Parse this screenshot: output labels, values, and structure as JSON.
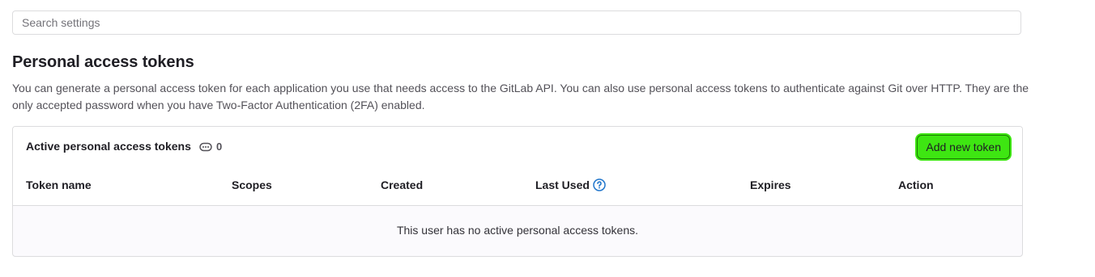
{
  "search": {
    "placeholder": "Search settings"
  },
  "section": {
    "title": "Personal access tokens",
    "description": "You can generate a personal access token for each application you use that needs access to the GitLab API. You can also use personal access tokens to authenticate against Git over HTTP. They are the only accepted password when you have Two-Factor Authentication (2FA) enabled."
  },
  "tokens_card": {
    "title": "Active personal access tokens",
    "count_icon": "token-icon",
    "count": "0",
    "add_button_label": "Add new token",
    "columns": [
      "Token name",
      "Scopes",
      "Created",
      "Last Used",
      "Expires",
      "Action"
    ],
    "help_icon": "question-circle-icon",
    "empty_message": "This user has no active personal access tokens."
  },
  "colors": {
    "highlight": "#3ee612",
    "help_icon": "#1f75cb",
    "border": "#dcdcde"
  }
}
